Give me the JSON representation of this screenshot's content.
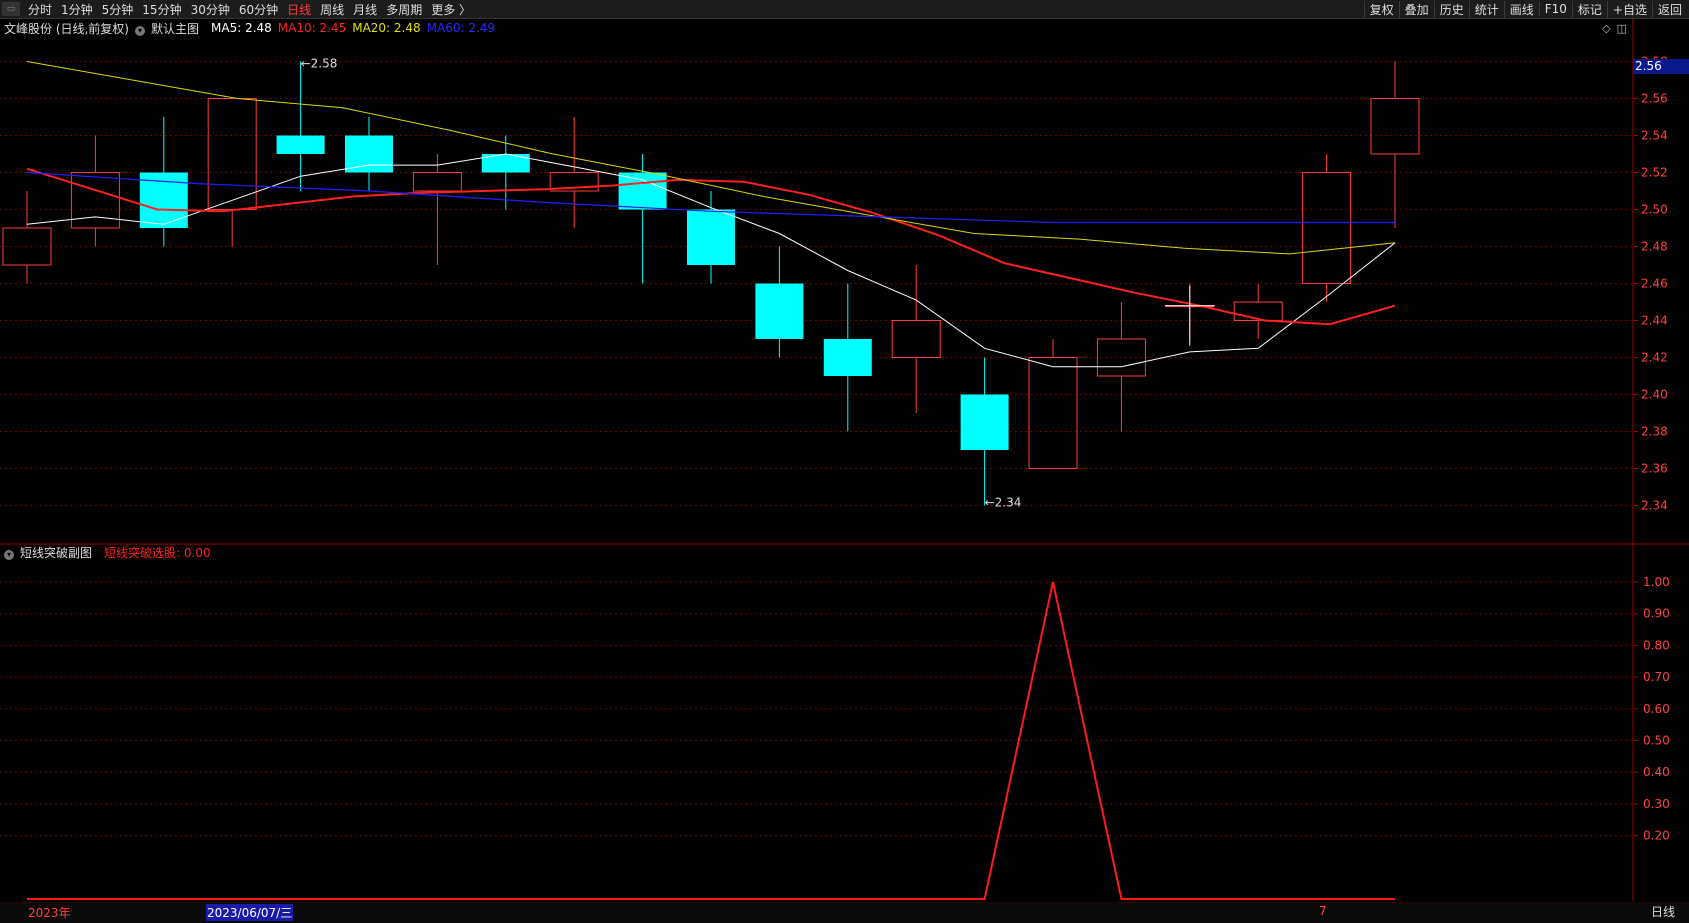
{
  "toolbar": {
    "periods": [
      "分时",
      "1分钟",
      "5分钟",
      "15分钟",
      "30分钟",
      "60分钟",
      "日线",
      "周线",
      "月线",
      "多周期",
      "更多 〉"
    ],
    "active_period": "日线",
    "right_buttons": [
      "复权",
      "叠加",
      "历史",
      "统计",
      "画线",
      "F10",
      "标记",
      "+自选",
      "返回"
    ]
  },
  "main_legend": {
    "stock": "文峰股份 (日线,前复权)",
    "chart_name": "默认主图",
    "ma5": "MA5: 2.48",
    "ma10": "MA10: 2.45",
    "ma20": "MA20: 2.48",
    "ma60": "MA60: 2.49"
  },
  "sub_legend": {
    "chart_name": "短线突破副图",
    "indicator": "短线突破选股: 0.00"
  },
  "bottom": {
    "year": "2023年",
    "cursor_date": "2023/06/07/三",
    "month_marker": "7",
    "period": "日线"
  },
  "price_tag": "2.56",
  "colors": {
    "up": "#ff3b3b",
    "down": "#00ffff",
    "ma5": "#ffffff",
    "ma10": "#ff2020",
    "ma20": "#d8d800",
    "ma60": "#2020ff",
    "grid": "#6b0000",
    "axis_text": "#ff4040"
  },
  "chart_data": [
    {
      "type": "candlestick",
      "title": "文峰股份 (日线,前复权)",
      "ylim": [
        2.33,
        2.59
      ],
      "y_ticks": [
        2.34,
        2.36,
        2.38,
        2.4,
        2.42,
        2.44,
        2.46,
        2.48,
        2.5,
        2.52,
        2.54,
        2.56,
        2.58
      ],
      "annotations": [
        {
          "text": "2.58",
          "index": 4
        },
        {
          "text": "2.34",
          "index": 14
        }
      ],
      "candles": [
        {
          "o": 2.47,
          "h": 2.51,
          "l": 2.46,
          "c": 2.49
        },
        {
          "o": 2.49,
          "h": 2.54,
          "l": 2.48,
          "c": 2.52
        },
        {
          "o": 2.52,
          "h": 2.55,
          "l": 2.48,
          "c": 2.49
        },
        {
          "o": 2.5,
          "h": 2.56,
          "l": 2.48,
          "c": 2.56
        },
        {
          "o": 2.54,
          "h": 2.58,
          "l": 2.51,
          "c": 2.53
        },
        {
          "o": 2.54,
          "h": 2.55,
          "l": 2.51,
          "c": 2.52
        },
        {
          "o": 2.51,
          "h": 2.53,
          "l": 2.47,
          "c": 2.52
        },
        {
          "o": 2.53,
          "h": 2.54,
          "l": 2.5,
          "c": 2.52
        },
        {
          "o": 2.51,
          "h": 2.55,
          "l": 2.49,
          "c": 2.52
        },
        {
          "o": 2.52,
          "h": 2.53,
          "l": 2.46,
          "c": 2.5
        },
        {
          "o": 2.5,
          "h": 2.51,
          "l": 2.46,
          "c": 2.47
        },
        {
          "o": 2.46,
          "h": 2.48,
          "l": 2.42,
          "c": 2.43
        },
        {
          "o": 2.43,
          "h": 2.46,
          "l": 2.38,
          "c": 2.41
        },
        {
          "o": 2.42,
          "h": 2.47,
          "l": 2.39,
          "c": 2.44
        },
        {
          "o": 2.4,
          "h": 2.42,
          "l": 2.34,
          "c": 2.37
        },
        {
          "o": 2.36,
          "h": 2.43,
          "l": 2.36,
          "c": 2.42
        },
        {
          "o": 2.41,
          "h": 2.45,
          "l": 2.38,
          "c": 2.43
        },
        {
          "o": 2.448,
          "h": 2.46,
          "l": 2.43,
          "c": 2.448
        },
        {
          "o": 2.44,
          "h": 2.46,
          "l": 2.43,
          "c": 2.45
        },
        {
          "o": 2.46,
          "h": 2.53,
          "l": 2.45,
          "c": 2.52
        },
        {
          "o": 2.53,
          "h": 2.58,
          "l": 2.49,
          "c": 2.56
        }
      ],
      "series": [
        {
          "name": "MA5",
          "values": [
            2.492,
            2.496,
            2.492,
            2.505,
            2.518,
            2.524,
            2.524,
            2.53,
            2.523,
            2.516,
            2.501,
            2.487,
            2.467,
            2.451,
            2.425,
            2.415,
            2.415,
            2.423,
            2.425,
            2.453,
            2.482
          ]
        },
        {
          "name": "MA10",
          "values": [
            2.522,
            2.511,
            2.5,
            2.499,
            2.503,
            2.507,
            2.509,
            2.51,
            2.511,
            2.513,
            2.516,
            2.515,
            2.508,
            2.498,
            2.486,
            2.471,
            2.463,
            2.455,
            2.448,
            2.44,
            2.438,
            2.448
          ]
        },
        {
          "name": "MA20",
          "values": [
            2.58,
            2.57,
            2.56,
            2.555,
            2.543,
            2.53,
            2.519,
            2.507,
            2.497,
            2.487,
            2.484,
            2.479,
            2.476,
            2.482
          ]
        },
        {
          "name": "MA60",
          "values": [
            2.52,
            2.514,
            2.51,
            2.504,
            2.499,
            2.496,
            2.493,
            2.493,
            2.493
          ]
        }
      ]
    },
    {
      "type": "line",
      "title": "短线突破副图",
      "ylim": [
        0,
        1.06
      ],
      "y_ticks": [
        0.2,
        0.3,
        0.4,
        0.5,
        0.6,
        0.7,
        0.8,
        0.9,
        1.0
      ],
      "series": [
        {
          "name": "短线突破选股",
          "values": [
            0,
            0,
            0,
            0,
            0,
            0,
            0,
            0,
            0,
            0,
            0,
            0,
            0,
            0,
            0,
            1,
            0,
            0,
            0,
            0,
            0
          ]
        }
      ]
    }
  ]
}
